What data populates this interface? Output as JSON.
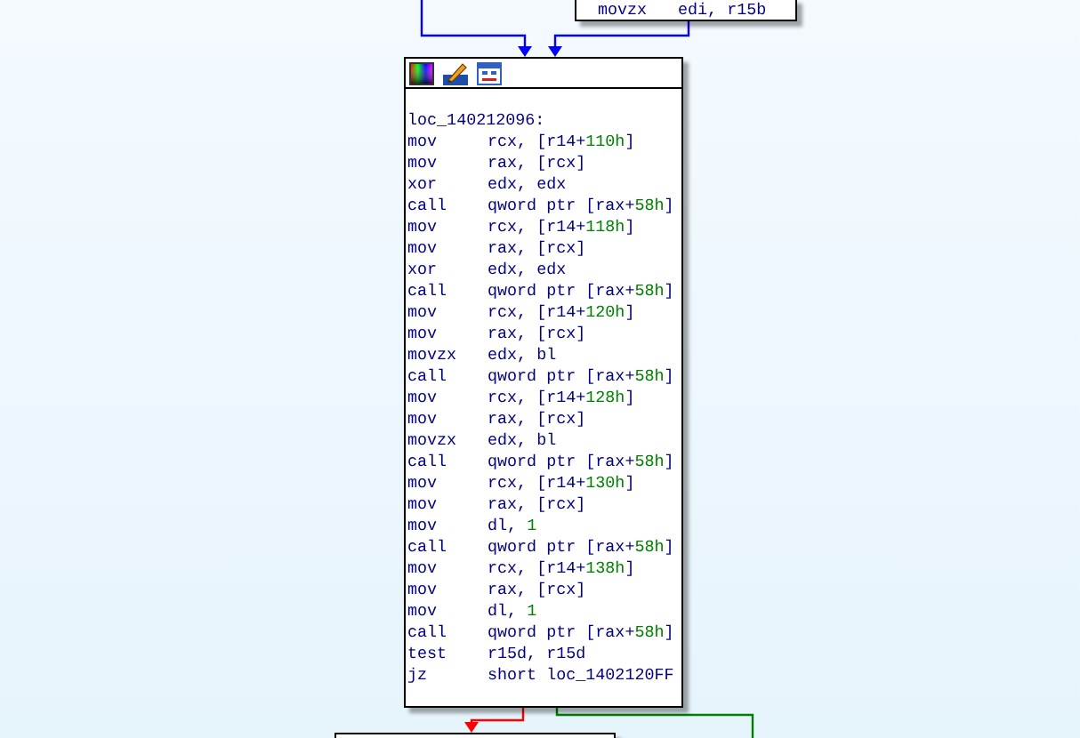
{
  "top_block": {
    "lines": [
      {
        "mnemonic": "movzx",
        "operands": [
          {
            "text": "edi, r15b"
          }
        ]
      }
    ]
  },
  "block": {
    "label": "loc_140212096:",
    "lines": [
      {
        "mnemonic": "mov",
        "operands": [
          {
            "text": "rcx, [r14+"
          },
          {
            "text": "110h",
            "kind": "number"
          },
          {
            "text": "]"
          }
        ]
      },
      {
        "mnemonic": "mov",
        "operands": [
          {
            "text": "rax, [rcx]"
          }
        ]
      },
      {
        "mnemonic": "xor",
        "operands": [
          {
            "text": "edx, edx"
          }
        ]
      },
      {
        "mnemonic": "call",
        "operands": [
          {
            "text": "qword ptr [rax+"
          },
          {
            "text": "58h",
            "kind": "number"
          },
          {
            "text": "]"
          }
        ]
      },
      {
        "mnemonic": "mov",
        "operands": [
          {
            "text": "rcx, [r14+"
          },
          {
            "text": "118h",
            "kind": "number"
          },
          {
            "text": "]"
          }
        ]
      },
      {
        "mnemonic": "mov",
        "operands": [
          {
            "text": "rax, [rcx]"
          }
        ]
      },
      {
        "mnemonic": "xor",
        "operands": [
          {
            "text": "edx, edx"
          }
        ]
      },
      {
        "mnemonic": "call",
        "operands": [
          {
            "text": "qword ptr [rax+"
          },
          {
            "text": "58h",
            "kind": "number"
          },
          {
            "text": "]"
          }
        ]
      },
      {
        "mnemonic": "mov",
        "operands": [
          {
            "text": "rcx, [r14+"
          },
          {
            "text": "120h",
            "kind": "number"
          },
          {
            "text": "]"
          }
        ]
      },
      {
        "mnemonic": "mov",
        "operands": [
          {
            "text": "rax, [rcx]"
          }
        ]
      },
      {
        "mnemonic": "movzx",
        "operands": [
          {
            "text": "edx, bl"
          }
        ]
      },
      {
        "mnemonic": "call",
        "operands": [
          {
            "text": "qword ptr [rax+"
          },
          {
            "text": "58h",
            "kind": "number"
          },
          {
            "text": "]"
          }
        ]
      },
      {
        "mnemonic": "mov",
        "operands": [
          {
            "text": "rcx, [r14+"
          },
          {
            "text": "128h",
            "kind": "number"
          },
          {
            "text": "]"
          }
        ]
      },
      {
        "mnemonic": "mov",
        "operands": [
          {
            "text": "rax, [rcx]"
          }
        ]
      },
      {
        "mnemonic": "movzx",
        "operands": [
          {
            "text": "edx, bl"
          }
        ]
      },
      {
        "mnemonic": "call",
        "operands": [
          {
            "text": "qword ptr [rax+"
          },
          {
            "text": "58h",
            "kind": "number"
          },
          {
            "text": "]"
          }
        ]
      },
      {
        "mnemonic": "mov",
        "operands": [
          {
            "text": "rcx, [r14+"
          },
          {
            "text": "130h",
            "kind": "number"
          },
          {
            "text": "]"
          }
        ]
      },
      {
        "mnemonic": "mov",
        "operands": [
          {
            "text": "rax, [rcx]"
          }
        ]
      },
      {
        "mnemonic": "mov",
        "operands": [
          {
            "text": "dl, "
          },
          {
            "text": "1",
            "kind": "number"
          }
        ]
      },
      {
        "mnemonic": "call",
        "operands": [
          {
            "text": "qword ptr [rax+"
          },
          {
            "text": "58h",
            "kind": "number"
          },
          {
            "text": "]"
          }
        ]
      },
      {
        "mnemonic": "mov",
        "operands": [
          {
            "text": "rcx, [r14+"
          },
          {
            "text": "138h",
            "kind": "number"
          },
          {
            "text": "]"
          }
        ]
      },
      {
        "mnemonic": "mov",
        "operands": [
          {
            "text": "rax, [rcx]"
          }
        ]
      },
      {
        "mnemonic": "mov",
        "operands": [
          {
            "text": "dl, "
          },
          {
            "text": "1",
            "kind": "number"
          }
        ]
      },
      {
        "mnemonic": "call",
        "operands": [
          {
            "text": "qword ptr [rax+"
          },
          {
            "text": "58h",
            "kind": "number"
          },
          {
            "text": "]"
          }
        ]
      },
      {
        "mnemonic": "test",
        "operands": [
          {
            "text": "r15d, r15d"
          }
        ]
      },
      {
        "mnemonic": "jz",
        "operands": [
          {
            "text": "short loc_1402120FF"
          }
        ]
      }
    ]
  },
  "edges": [
    {
      "kind": "unconditional"
    },
    {
      "kind": "unconditional"
    },
    {
      "kind": "taken"
    },
    {
      "kind": "not_taken"
    }
  ]
}
